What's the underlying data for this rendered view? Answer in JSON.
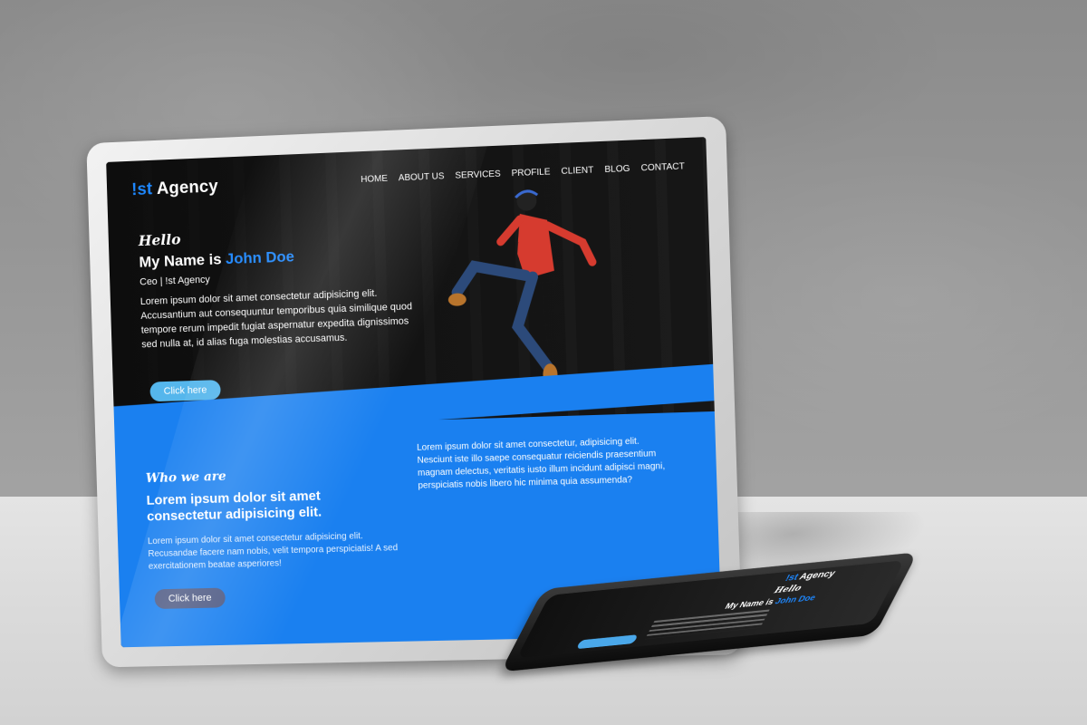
{
  "site": {
    "logo_prefix": "!st",
    "logo_suffix": " Agency",
    "nav": [
      "HOME",
      "ABOUT US",
      "SERVICES",
      "PROFILE",
      "CLIENT",
      "BLOG",
      "CONTACT"
    ],
    "hero": {
      "greeting": "Hello",
      "name_prefix": "My Name is ",
      "name": "John Doe",
      "role": "Ceo | !st Agency",
      "text": "Lorem ipsum dolor sit amet consectetur adipisicing elit. Accusantium aut consequuntur temporibus quia similique quod tempore rerum impedit fugiat aspernatur expedita dignissimos sed nulla at, id alias fuga molestias accusamus.",
      "button": "Click here"
    },
    "about": {
      "heading": "Who we are",
      "title": "Lorem ipsum dolor sit amet consectetur adipisicing elit.",
      "text_left": "Lorem ipsum dolor sit amet consectetur adipisicing elit. Recusandae facere nam nobis, velit tempora perspiciatis! A sed exercitationem beatae asperiores!",
      "text_right": "Lorem ipsum dolor sit amet consectetur, adipisicing elit. Nesciunt iste illo saepe consequatur reiciendis praesentium magnam delectus, veritatis iusto illum incidunt adipisci magni, perspiciatis nobis libero hic minima quia assumenda?",
      "button": "Click here"
    }
  },
  "colors": {
    "accent_blue": "#1e88ff",
    "section_blue": "#1a80f0",
    "hero_button": "#55b6ec",
    "about_button": "#4f5b85"
  }
}
